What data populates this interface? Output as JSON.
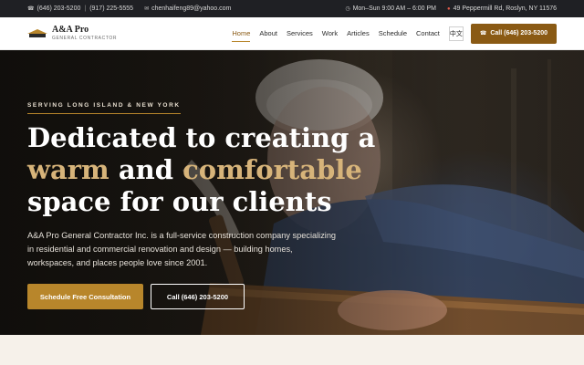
{
  "topbar": {
    "phone1": "(646) 203-5200",
    "phone_sep": "|",
    "phone2": "(917) 225-5555",
    "email": "chenhaifeng89@yahoo.com",
    "hours": "Mon–Sun 9:00 AM – 6:00 PM",
    "address": "49 Peppermill Rd, Roslyn, NY 11576"
  },
  "logo": {
    "title": "A&A Pro",
    "subtitle": "GENERAL CONTRACTOR",
    "mark_text": "A&A"
  },
  "nav": {
    "items": [
      {
        "label": "Home",
        "active": true
      },
      {
        "label": "About"
      },
      {
        "label": "Services"
      },
      {
        "label": "Work"
      },
      {
        "label": "Articles"
      },
      {
        "label": "Schedule"
      },
      {
        "label": "Contact"
      }
    ],
    "lang_label": "中文",
    "cta_label": "Call (646) 203-5200"
  },
  "hero": {
    "eyebrow": "SERVING LONG ISLAND & NEW YORK",
    "headline_part1": "Dedicated to creating a ",
    "headline_accent1": "warm",
    "headline_part2": " and ",
    "headline_accent2": "comfortable",
    "headline_part3": " space for our clients",
    "lead": "A&A Pro General Contractor Inc. is a full-service construction company specializing in residential and commercial renovation and design — building homes, workspaces, and places people love since 2001.",
    "primary_button": "Schedule Free Consultation",
    "secondary_button": "Call (646) 203-5200"
  },
  "icons": {
    "phone": "phone-icon",
    "email": "email-icon",
    "clock": "clock-icon",
    "pin": "map-pin-icon"
  },
  "colors": {
    "accent": "#b8862b",
    "accent_dark": "#8a5a14",
    "highlight_text": "#d7b47a",
    "topbar_bg": "#1f2024"
  }
}
